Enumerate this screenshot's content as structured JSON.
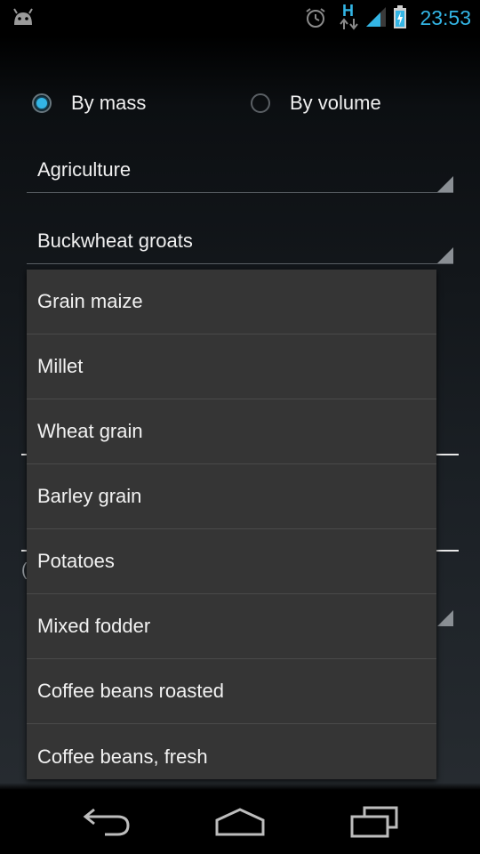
{
  "status_bar": {
    "time": "23:53",
    "network_type": "H",
    "icons": [
      "android-icon",
      "alarm-icon",
      "data-arrows-icon",
      "signal-icon",
      "battery-charging-icon"
    ]
  },
  "unit_mode": {
    "options": [
      {
        "label": "By mass",
        "checked": true
      },
      {
        "label": "By volume",
        "checked": false
      }
    ]
  },
  "category_spinner": {
    "selected": "Agriculture"
  },
  "product_spinner": {
    "selected": "Buckwheat groats"
  },
  "background": {
    "partial_char": "("
  },
  "dropdown": {
    "items": [
      "Grain maize",
      "Millet",
      "Wheat grain",
      "Barley grain",
      "Potatoes",
      "Mixed fodder",
      "Coffee beans roasted",
      "Coffee beans, fresh"
    ]
  },
  "navigation": {
    "buttons": [
      "back-icon",
      "home-icon",
      "recent-apps-icon"
    ]
  },
  "colors": {
    "accent": "#33b5e5",
    "dropdown_bg": "#353535",
    "text": "#f2f2f2"
  }
}
